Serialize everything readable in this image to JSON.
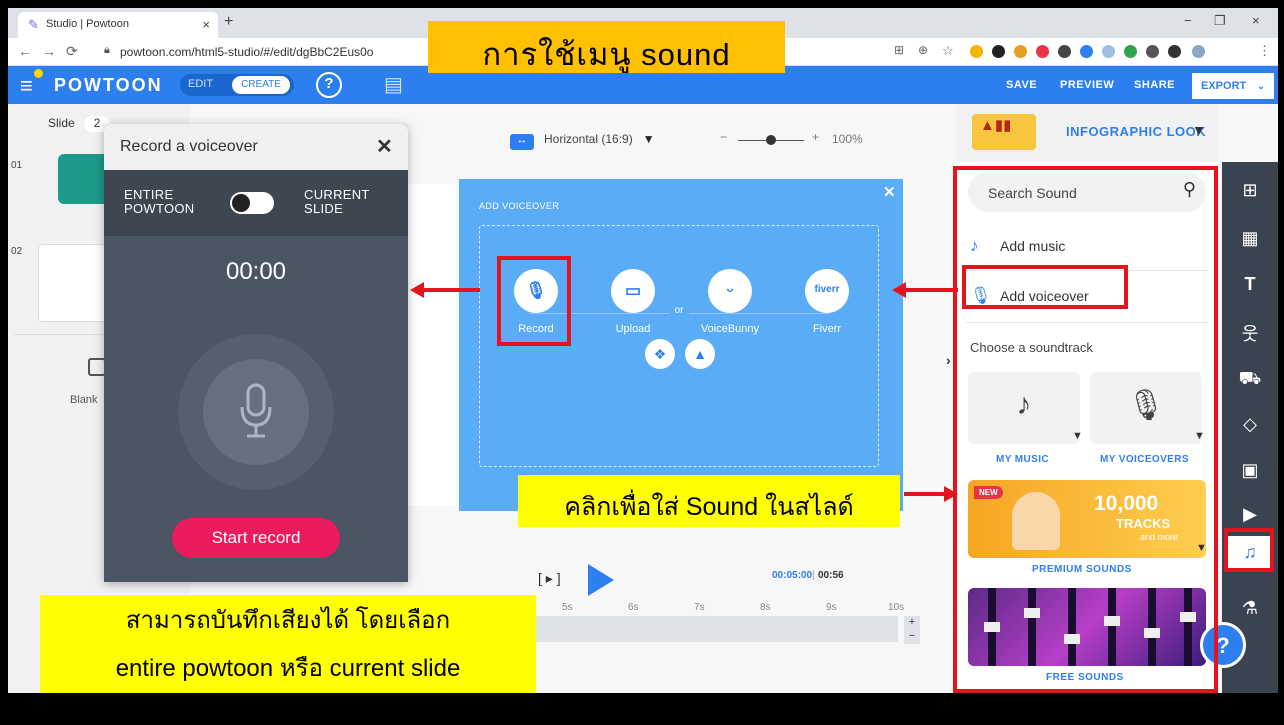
{
  "browser": {
    "tab_title": "Studio | Powtoon",
    "tab_close": "×",
    "new_tab": "+",
    "url": "powtoon.com/html5-studio/#/edit/dgBbC2Eus0o",
    "win_min": "−",
    "win_max": "❐",
    "win_close": "×"
  },
  "app": {
    "brand": "POWTOON",
    "mode_edit": "EDIT",
    "mode_create": "CREATE",
    "help": "?",
    "save": "SAVE",
    "preview": "PREVIEW",
    "share": "SHARE",
    "export": "EXPORT"
  },
  "slides": {
    "label": "Slide",
    "count": "2",
    "nums": [
      "01",
      "02"
    ],
    "blank_label": "Blank"
  },
  "voiceover_panel": {
    "title": "Record a voiceover",
    "close": "✕",
    "option_left": "ENTIRE\nPOWTOON",
    "option_right": "CURRENT\nSLIDE",
    "time": "00:00",
    "start_button": "Start record"
  },
  "canvas": {
    "orientation": "Horizontal (16:9)",
    "zoom": "100%"
  },
  "add_voiceover": {
    "title": "ADD VOICEOVER",
    "close": "✕",
    "options": [
      {
        "label": "Record",
        "icon": "microphone-icon"
      },
      {
        "label": "Upload",
        "icon": "monitor-icon"
      },
      {
        "label": "VoiceBunny",
        "icon": "bunny-icon"
      },
      {
        "label": "Fiverr",
        "icon": "fiverr-logo",
        "logo_text": "fiverr"
      }
    ],
    "or": "or"
  },
  "timeline": {
    "current": "00:05:00",
    "total": "00:56",
    "ticks": [
      "5s",
      "6s",
      "7s",
      "8s",
      "9s",
      "10s"
    ]
  },
  "right_panel": {
    "look_label": "INFOGRAPHIC LOOK",
    "search_placeholder": "Search Sound",
    "add_music": "Add music",
    "add_voiceover": "Add voiceover",
    "choose": "Choose a soundtrack",
    "my_music": "MY MUSIC",
    "my_voiceovers": "MY VOICEOVERS",
    "premium_new": "NEW",
    "premium_count": "10,000",
    "premium_tracks": "TRACKS",
    "premium_more": "and more",
    "premium_label": "PREMIUM SOUNDS",
    "free_label": "FREE SOUNDS"
  },
  "annotations": {
    "title": "การใช้เมนู sound",
    "middle": "คลิกเพื่อใส่ Sound ในสไลด์",
    "bottom_line1": "สามารถบันทึกเสียงได้ โดยเลือก",
    "bottom_line2": "entire powtoon หรือ current slide"
  },
  "colors": {
    "accent": "#2d7ff0",
    "highlight": "#e3141e",
    "record_button": "#ec1b5e",
    "callout_title": "#ffc000",
    "callout_note": "#ffff00"
  }
}
